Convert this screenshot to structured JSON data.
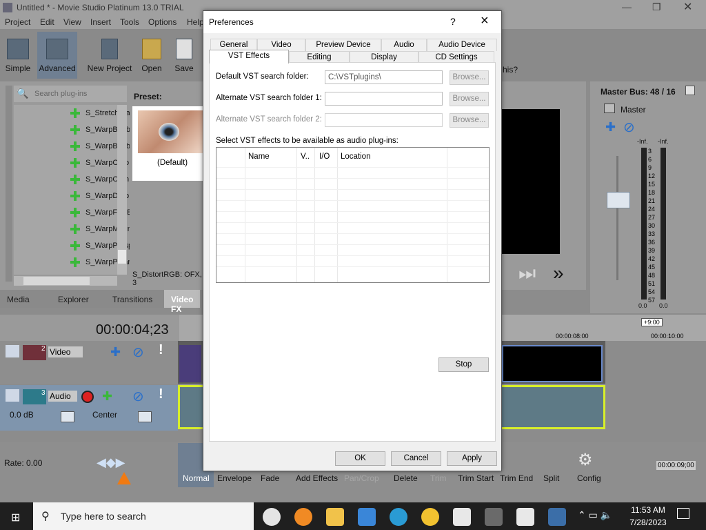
{
  "window": {
    "title": "Untitled * - Movie Studio Platinum 13.0 TRIAL"
  },
  "menu": [
    "Project",
    "Edit",
    "View",
    "Insert",
    "Tools",
    "Options",
    "Help"
  ],
  "toolbar": {
    "simple": "Simple",
    "advanced": "Advanced",
    "new_project": "New Project",
    "open": "Open",
    "save": "Save",
    "help_partial": "his?"
  },
  "plugins": {
    "search_placeholder": "Search plug-ins",
    "items": [
      "S_StretchFra",
      "S_WarpBubb",
      "S_WarpBubb",
      "S_WarpChro",
      "S_WarpCorn",
      "S_WarpDrop",
      "S_WarpFishE",
      "S_WarpMagn",
      "S_WarpPersp",
      "S_WarpPolar"
    ],
    "preset_label": "Preset:",
    "preset_default": "(Default)",
    "status": "S_DistortRGB: OFX, 3"
  },
  "tabs": [
    "Media",
    "Explorer",
    "Transitions",
    "Video FX"
  ],
  "timeline": {
    "timecode": "00:00:04;23",
    "video_track": "Video",
    "video_num": "2",
    "audio_track": "Audio",
    "audio_num": "3",
    "volume": "0.0 dB",
    "pan": "Center",
    "mark_8": "00:00:08:00",
    "mark_10": "00:00:10:00",
    "cursor_pos": "+9:00",
    "rate": "Rate: 0.00",
    "end_time": "00:00:09;00"
  },
  "master": {
    "title": "Master Bus: 48 / 16",
    "label": "Master",
    "inf_l": "-Inf.",
    "inf_r": "-Inf.",
    "scale": [
      "3",
      "6",
      "9",
      "12",
      "15",
      "18",
      "21",
      "24",
      "27",
      "30",
      "33",
      "36",
      "39",
      "42",
      "45",
      "48",
      "51",
      "54",
      "57"
    ],
    "zero_l": "0.0",
    "zero_r": "0.0"
  },
  "bottom_tools": [
    "Normal",
    "Envelope",
    "Fade",
    "Add Effects",
    "Pan/Crop",
    "Delete",
    "Trim",
    "Trim Start",
    "Trim End",
    "Split",
    "Config"
  ],
  "dialog": {
    "title": "Preferences",
    "help": "?",
    "close": "×",
    "tabs_row1": [
      "General",
      "Video",
      "Preview Device",
      "Audio",
      "Audio Device"
    ],
    "tabs_row2": [
      "VST Effects",
      "Editing",
      "Display",
      "CD Settings"
    ],
    "default_label": "Default VST search folder:",
    "default_value": "C:\\VSTplugins\\",
    "alt1_label": "Alternate VST search folder 1:",
    "alt1_value": "",
    "alt2_label": "Alternate VST search folder 2:",
    "alt2_value": "",
    "browse": "Browse...",
    "select_label": "Select VST effects to be available as audio plug-ins:",
    "columns": [
      "Name",
      "V..",
      "I/O",
      "Location"
    ],
    "stop": "Stop",
    "ok": "OK",
    "cancel": "Cancel",
    "apply": "Apply"
  },
  "taskbar": {
    "search": "Type here to search",
    "time": "11:53 AM",
    "date": "7/28/2023"
  }
}
